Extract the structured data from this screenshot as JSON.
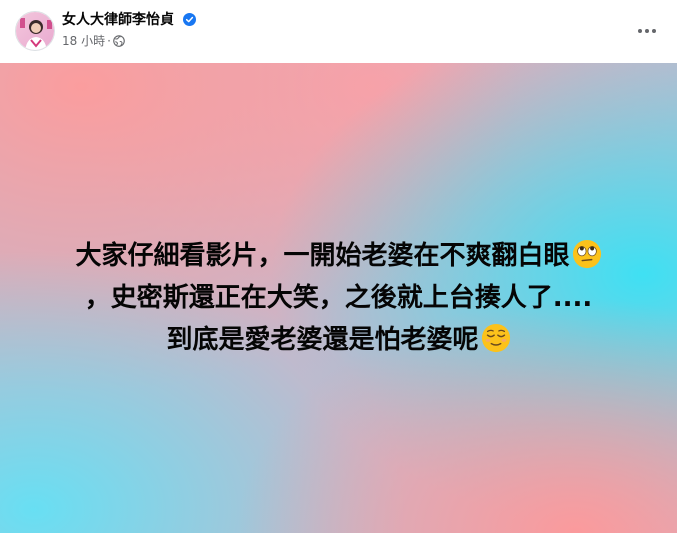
{
  "header": {
    "author_name": "女人大律師李怡貞",
    "time": "18 小時",
    "separator": "·",
    "privacy_icon": "globe-icon",
    "verified_icon": "verified-badge-icon",
    "more_icon": "more-options-icon"
  },
  "post": {
    "lines": [
      "大家仔細看影片，一開始老婆在不爽翻白眼",
      "，史密斯還正在大笑，之後就上台揍人了....",
      "到底是愛老婆還是怕老婆呢"
    ],
    "line1_emoji": "eye-roll-emoji",
    "line3_emoji": "relieved-emoji",
    "background_colors": [
      "#f7a3a6",
      "#4fd8ee",
      "#f2a7c0"
    ]
  },
  "colors": {
    "text": "#050505",
    "secondary_text": "#65676b",
    "verified_blue": "#1877f2"
  }
}
